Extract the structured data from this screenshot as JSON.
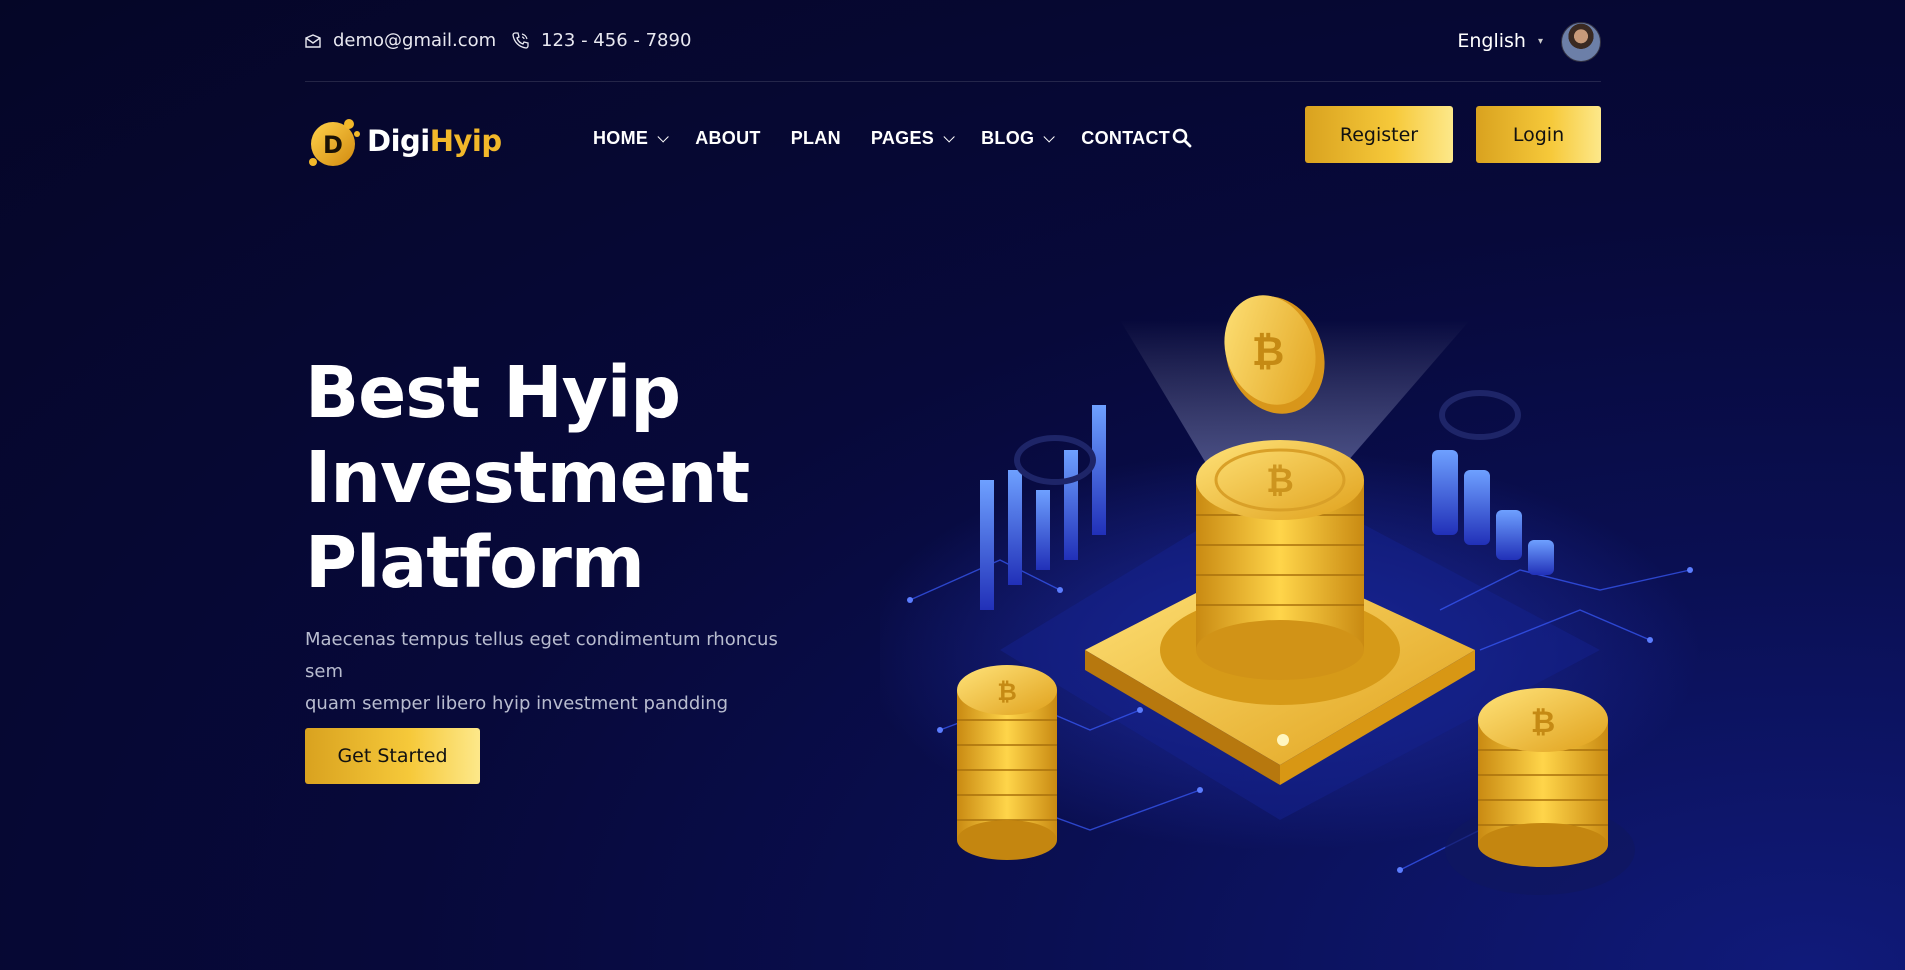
{
  "topbar": {
    "email": "demo@gmail.com",
    "phone": "123 - 456 - 7890",
    "language": "English"
  },
  "logo": {
    "part1": "Digi",
    "part2": "Hyip",
    "letter": "D"
  },
  "nav": {
    "items": [
      {
        "label": "HOME",
        "dropdown": true
      },
      {
        "label": "ABOUT",
        "dropdown": false
      },
      {
        "label": "PLAN",
        "dropdown": false
      },
      {
        "label": "PAGES",
        "dropdown": true
      },
      {
        "label": "BLOG",
        "dropdown": true
      },
      {
        "label": "CONTACT",
        "dropdown": false
      }
    ],
    "register_label": "Register",
    "login_label": "Login"
  },
  "hero": {
    "title_line1": "Best Hyip",
    "title_line2": "Investment",
    "title_line3": "Platform",
    "subtitle_line1": "Maecenas tempus tellus eget condimentum rhoncus sem",
    "subtitle_line2": "quam semper libero hyip investment pandding",
    "cta_label": "Get Started"
  },
  "colors": {
    "accent_gold": "#f6c93a",
    "bg_dark": "#050627",
    "bg_blue": "#101a7a"
  }
}
